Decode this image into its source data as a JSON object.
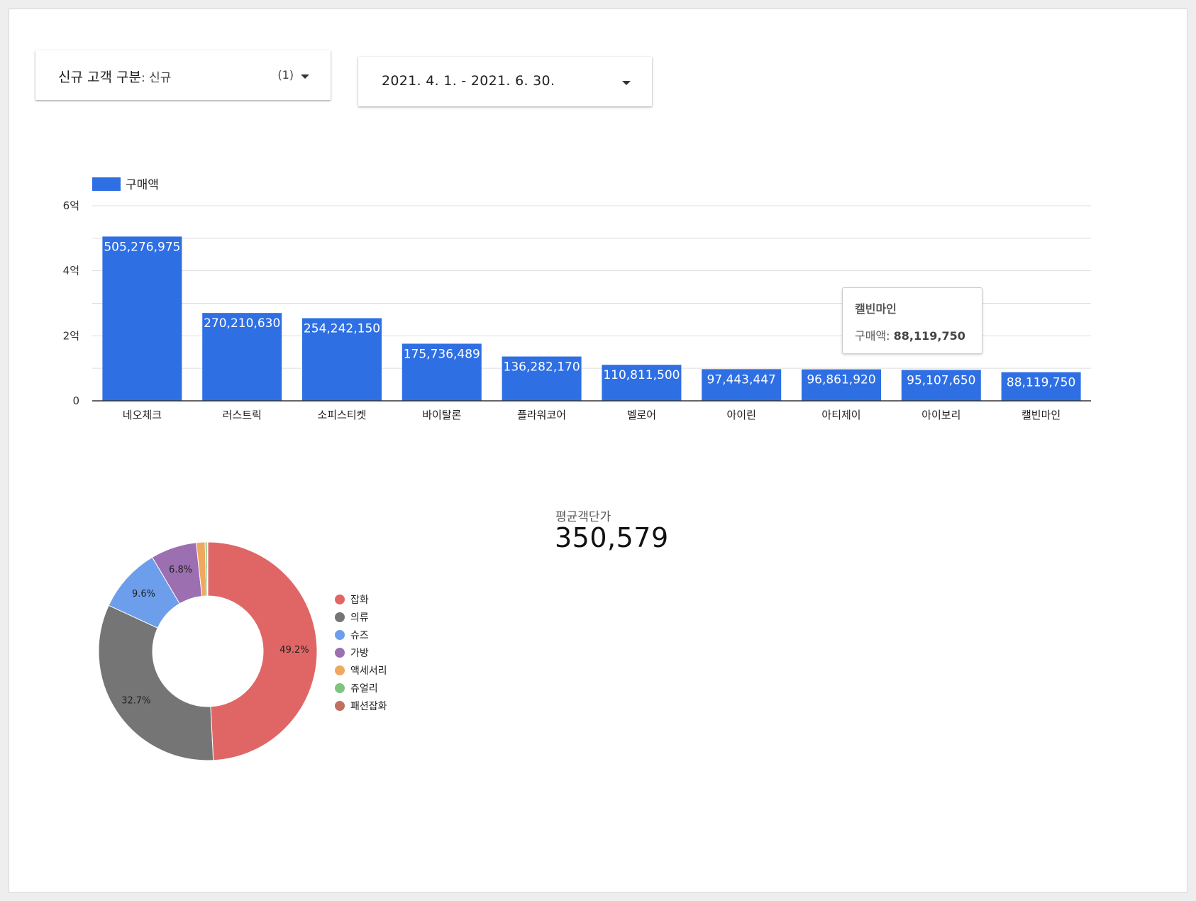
{
  "filter": {
    "label": "신규 고객 구분",
    "separator": ": ",
    "value": "신규",
    "count": "(1)"
  },
  "date_range": {
    "label": "2021. 4. 1. - 2021. 6. 30."
  },
  "chart_data": [
    {
      "type": "bar",
      "legend": "구매액",
      "legend_position": "top-left",
      "color": "#2f6fe4",
      "categories": [
        "네오체크",
        "러스트릭",
        "소피스티켓",
        "바이탈론",
        "플라워코어",
        "벨로어",
        "아이린",
        "아티제이",
        "아이보리",
        "캘빈마인"
      ],
      "values": [
        505276975,
        270210630,
        254242150,
        175736489,
        136282170,
        110811500,
        97443447,
        96861920,
        95107650,
        88119750
      ],
      "data_labels": [
        "505,276,975",
        "270,210,630",
        "254,242,150",
        "175,736,489",
        "136,282,170",
        "110,811,500",
        "97,443,447",
        "96,861,920",
        "95,107,650",
        "88,119,750"
      ],
      "yticks": [
        {
          "value": 0,
          "label": "0"
        },
        {
          "value": 200000000,
          "label": "2억"
        },
        {
          "value": 400000000,
          "label": "4억"
        },
        {
          "value": 600000000,
          "label": "6억"
        }
      ],
      "ylim": [
        0,
        600000000
      ],
      "grid": true
    },
    {
      "type": "pie",
      "style": "donut",
      "legend_position": "right",
      "slices": [
        {
          "label": "잡화",
          "value": 49.2,
          "display": "49.2%",
          "color": "#e06666"
        },
        {
          "label": "의류",
          "value": 32.7,
          "display": "32.7%",
          "color": "#757575"
        },
        {
          "label": "슈즈",
          "value": 9.6,
          "display": "9.6%",
          "color": "#6d9eeb"
        },
        {
          "label": "가방",
          "value": 6.8,
          "display": "6.8%",
          "color": "#9b6fb0"
        },
        {
          "label": "액세서리",
          "value": 1.3,
          "display": "",
          "color": "#f0a860"
        },
        {
          "label": "쥬얼리",
          "value": 0.3,
          "display": "",
          "color": "#7fc47f"
        },
        {
          "label": "패션잡화",
          "value": 0.1,
          "display": "",
          "color": "#c0705e"
        }
      ]
    }
  ],
  "tooltip": {
    "title": "캘빈마인",
    "metric": "구매액",
    "separator": ": ",
    "value": "88,119,750"
  },
  "scorecard": {
    "label": "평균객단가",
    "value": "350,579"
  }
}
